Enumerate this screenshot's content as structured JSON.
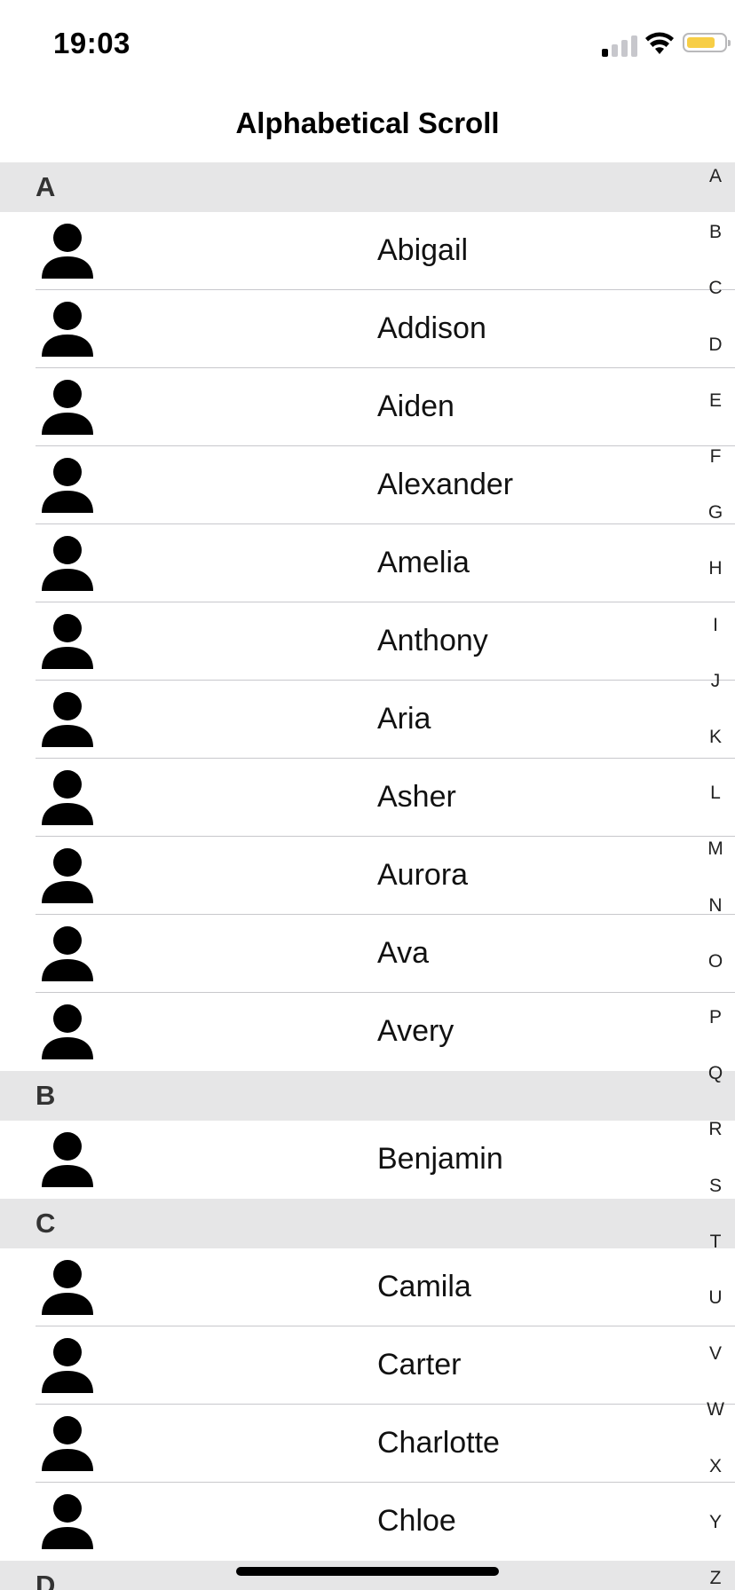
{
  "status_bar": {
    "time": "19:03"
  },
  "nav": {
    "title": "Alphabetical Scroll"
  },
  "sections": [
    {
      "letter": "A",
      "contacts": [
        "Abigail",
        "Addison",
        "Aiden",
        "Alexander",
        "Amelia",
        "Anthony",
        "Aria",
        "Asher",
        "Aurora",
        "Ava",
        "Avery"
      ]
    },
    {
      "letter": "B",
      "contacts": [
        "Benjamin"
      ]
    },
    {
      "letter": "C",
      "contacts": [
        "Camila",
        "Carter",
        "Charlotte",
        "Chloe"
      ]
    },
    {
      "letter": "D",
      "contacts": []
    }
  ],
  "index_letters": [
    "A",
    "B",
    "C",
    "D",
    "E",
    "F",
    "G",
    "H",
    "I",
    "J",
    "K",
    "L",
    "M",
    "N",
    "O",
    "P",
    "Q",
    "R",
    "S",
    "T",
    "U",
    "V",
    "W",
    "X",
    "Y",
    "Z"
  ],
  "icons": {
    "contact_avatar": "person-icon"
  }
}
